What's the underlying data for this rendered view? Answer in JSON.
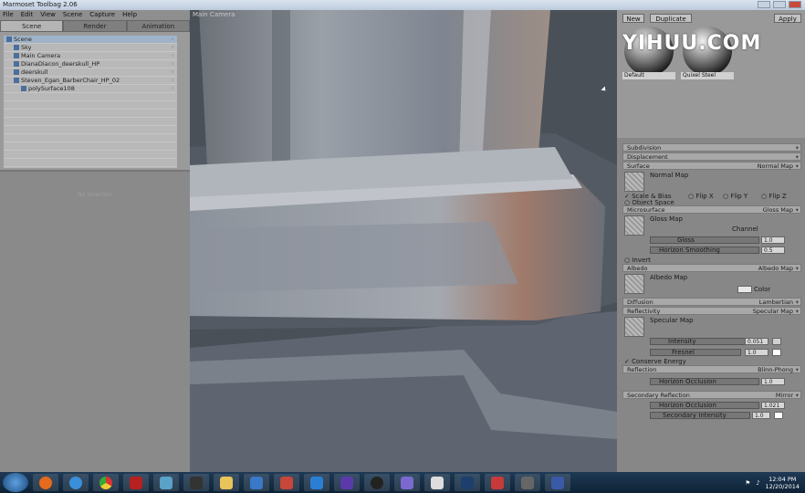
{
  "window": {
    "title": "Marmoset Toolbag 2.06"
  },
  "menu": [
    "File",
    "Edit",
    "View",
    "Scene",
    "Capture",
    "Help"
  ],
  "left_tabs": [
    {
      "label": "Scene",
      "active": true
    },
    {
      "label": "Render",
      "active": false
    },
    {
      "label": "Animation",
      "active": false
    }
  ],
  "scene_tree": [
    {
      "label": "Scene",
      "icon": "scene-icon",
      "indent": 0
    },
    {
      "label": "Sky",
      "icon": "sky-icon",
      "indent": 1
    },
    {
      "label": "Main Camera",
      "icon": "camera-icon",
      "indent": 1
    },
    {
      "label": "DianaDiacon_deerskull_HP",
      "icon": "mesh-icon",
      "indent": 1
    },
    {
      "label": "deerskull",
      "icon": "mesh-icon",
      "indent": 1
    },
    {
      "label": "Steven_Egan_BarberChair_HP_02",
      "icon": "mesh-icon",
      "indent": 1
    },
    {
      "label": "polySurface108",
      "icon": "mesh-icon",
      "indent": 2
    }
  ],
  "left_bottom": {
    "placeholder": "No Selection"
  },
  "viewport": {
    "label": "Main Camera"
  },
  "right_panel": {
    "new_label": "New",
    "duplicate_label": "Duplicate",
    "apply_label": "Apply",
    "watermark": "YIHUU.COM",
    "materials": [
      {
        "name": "Default"
      },
      {
        "name": "Quixel Steel"
      }
    ]
  },
  "sections": {
    "subdivision": {
      "label": "Subdivision"
    },
    "displacement": {
      "label": "Displacement"
    },
    "surface": {
      "label": "Surface",
      "value": "Normal Map"
    },
    "normal_map": {
      "label": "Normal Map",
      "scale_bias": "Scale & Bias",
      "flip_x": "Flip X",
      "flip_y": "Flip Y",
      "flip_z": "Flip Z",
      "object_space": "Object Space"
    },
    "microsurface": {
      "label": "Microsurface",
      "value": "Gloss Map"
    },
    "gloss_map": {
      "label": "Gloss Map",
      "channel_label": "Channel",
      "gloss_label": "Gloss",
      "gloss_value": "1.0",
      "horizon_label": "Horizon Smoothing",
      "horizon_value": "0.5",
      "invert": "Invert"
    },
    "albedo": {
      "label": "Albedo",
      "value": "Albedo Map"
    },
    "albedo_map": {
      "label": "Albedo Map",
      "color_label": "Color"
    },
    "diffusion": {
      "label": "Diffusion",
      "value": "Lambertian"
    },
    "reflectivity": {
      "label": "Reflectivity",
      "value": "Specular Map"
    },
    "specular_map": {
      "label": "Specular Map",
      "intensity_label": "Intensity",
      "intensity_value": "0.051",
      "fresnel_label": "Fresnel",
      "fresnel_value": "1.0",
      "conserve": "Conserve Energy"
    },
    "reflection": {
      "label": "Reflection",
      "value": "Blinn-Phong"
    },
    "reflection_props": {
      "horizon_occlusion_label": "Horizon Occlusion",
      "horizon_occlusion_value": "1.0"
    },
    "secondary": {
      "label": "Secondary Reflection",
      "value": "Mirror"
    },
    "secondary_props": {
      "horizon_label": "Horizon Occlusion",
      "horizon_value": "1.021",
      "intensity_label": "Secondary Intensity",
      "intensity_value": "1.0"
    }
  },
  "taskbar": {
    "time": "12:04 PM",
    "date": "12/20/2014"
  }
}
